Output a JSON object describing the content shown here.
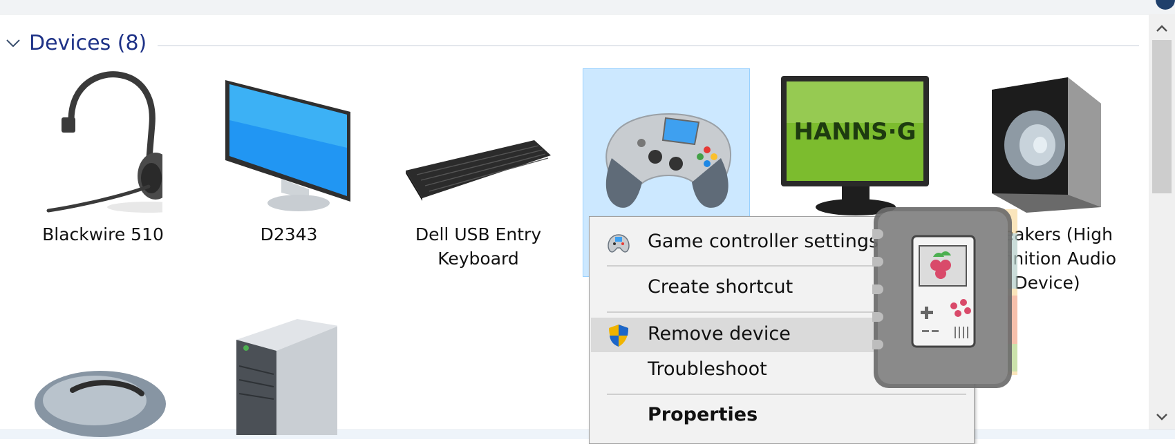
{
  "group": {
    "title": "Devices (8)"
  },
  "devices": [
    {
      "name": "Blackwire 510"
    },
    {
      "name": "D2343"
    },
    {
      "name": "Dell USB Entry Keyboard"
    },
    {
      "name": ""
    },
    {
      "name": ""
    },
    {
      "name": "Speakers (High Definition Audio Device)"
    },
    {
      "name": ""
    },
    {
      "name": ""
    }
  ],
  "context_menu": {
    "items": [
      {
        "label": "Game controller settings",
        "icon": "gamepad-icon"
      },
      {
        "label": "Create shortcut"
      },
      {
        "label": "Remove device",
        "icon": "uac-shield-icon",
        "highlighted": true
      },
      {
        "label": "Troubleshoot"
      },
      {
        "label": "Properties",
        "bold": true
      }
    ]
  },
  "monitor_brand": "HANNS·G",
  "colors": {
    "selection_fill": "#cce8ff",
    "selection_border": "#99d1ff",
    "group_title": "#1e3287",
    "menu_highlight": "#dadada"
  }
}
